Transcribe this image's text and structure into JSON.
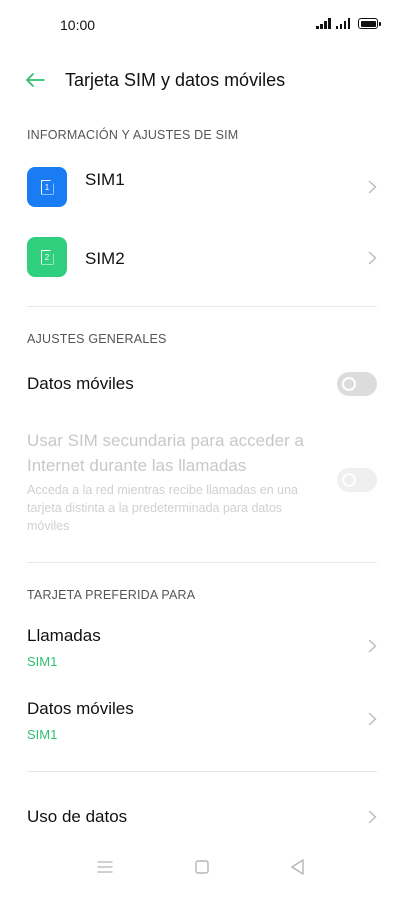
{
  "status_bar": {
    "time": "10:00"
  },
  "header": {
    "title": "Tarjeta SIM y datos móviles"
  },
  "sections": {
    "sim_info": {
      "header": "INFORMACIÓN Y AJUSTES DE SIM",
      "items": [
        {
          "label": "SIM1",
          "badge": "1",
          "color": "#1a7cf5"
        },
        {
          "label": "SIM2",
          "badge": "2",
          "color": "#2fcf7e"
        }
      ]
    },
    "general": {
      "header": "AJUSTES GENERALES",
      "mobile_data": {
        "label": "Datos móviles",
        "enabled": false
      },
      "secondary_sim": {
        "title": "Usar SIM secundaria para acceder a Internet durante las llamadas",
        "description": "Acceda a la red mientras recibe llamadas en una tarjeta distinta a la predeterminada para datos móviles",
        "enabled": false,
        "disabled": true
      }
    },
    "preferred": {
      "header": "TARJETA PREFERIDA PARA",
      "calls": {
        "label": "Llamadas",
        "value": "SIM1"
      },
      "data": {
        "label": "Datos móviles",
        "value": "SIM1"
      }
    },
    "data_usage": {
      "label": "Uso de datos"
    }
  },
  "colors": {
    "accent": "#2fbf71",
    "sim1": "#1a7cf5",
    "sim2": "#2fcf7e"
  }
}
